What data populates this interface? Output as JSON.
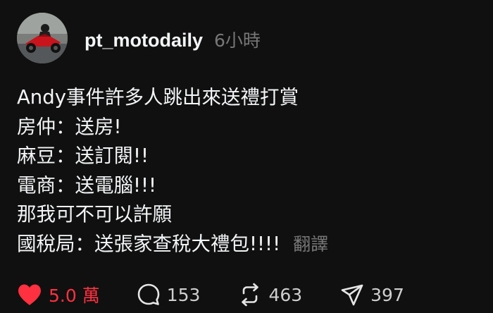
{
  "post": {
    "username": "pt_motodaily",
    "time": "6小時",
    "lines": [
      "Andy事件許多人跳出來送禮打賞",
      "房仲：送房!",
      "麻豆：送訂閱!!",
      "電商：送電腦!!!",
      "那我可不可以許願",
      "國稅局：送張家查稅大禮包!!!!"
    ],
    "translate_label": "翻譯"
  },
  "actions": {
    "likes": "5.0 萬",
    "comments": "153",
    "reposts": "463",
    "shares": "397"
  },
  "colors": {
    "background": "#101010",
    "text": "#f3f5f7",
    "secondary": "#777777",
    "like": "#ff3040"
  },
  "icons": {
    "like": "heart-filled-icon",
    "comment": "speech-bubble-icon",
    "repost": "repost-arrows-icon",
    "share": "paper-plane-icon"
  }
}
